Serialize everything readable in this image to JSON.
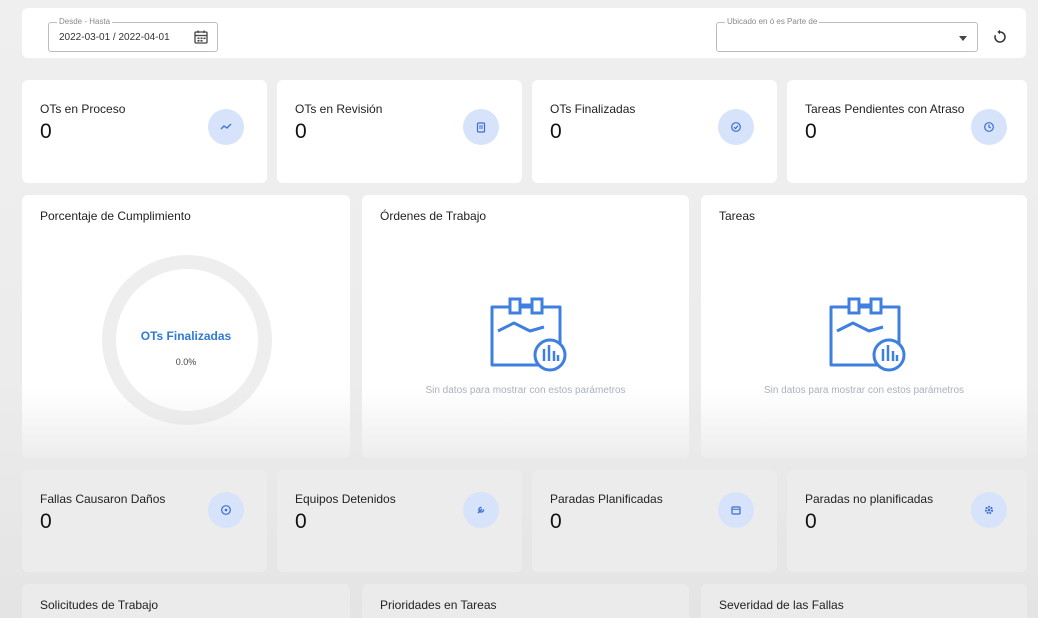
{
  "filters": {
    "date_range": {
      "label": "Desde - Hasta",
      "value": "2022-03-01 / 2022-04-01"
    },
    "location": {
      "label": "Ubicado en ó es Parte de",
      "value": ""
    }
  },
  "stats_top": [
    {
      "title": "OTs en Proceso",
      "value": "0",
      "icon": "trend-icon"
    },
    {
      "title": "OTs en Revisión",
      "value": "0",
      "icon": "clipboard-icon"
    },
    {
      "title": "OTs Finalizadas",
      "value": "0",
      "icon": "check-circle-icon"
    },
    {
      "title": "Tareas Pendientes con Atraso",
      "value": "0",
      "icon": "clock-icon"
    }
  ],
  "panels": {
    "compliance": {
      "title": "Porcentaje de Cumplimiento",
      "center_label": "OTs Finalizadas",
      "percent": "0.0%"
    },
    "work_orders": {
      "title": "Órdenes de Trabajo",
      "empty": "Sin datos para mostrar con estos parámetros"
    },
    "tasks": {
      "title": "Tareas",
      "empty": "Sin datos para mostrar con estos parámetros"
    }
  },
  "stats_bottom": [
    {
      "title": "Fallas Causaron Daños",
      "value": "0",
      "icon": "alert-circle-icon"
    },
    {
      "title": "Equipos Detenidos",
      "value": "0",
      "icon": "wrench-icon"
    },
    {
      "title": "Paradas Planificadas",
      "value": "0",
      "icon": "calendar-icon"
    },
    {
      "title": "Paradas no planificadas",
      "value": "0",
      "icon": "gear-icon"
    }
  ],
  "sections_bottom": [
    "Solicitudes de Trabajo",
    "Prioridades en Tareas",
    "Severidad de las Fallas"
  ],
  "colors": {
    "accent": "#2f7ad8",
    "icon_bg": "#d7e3fa",
    "icon_fg": "#3b6fd0",
    "empty_text": "#a9b0bc"
  }
}
